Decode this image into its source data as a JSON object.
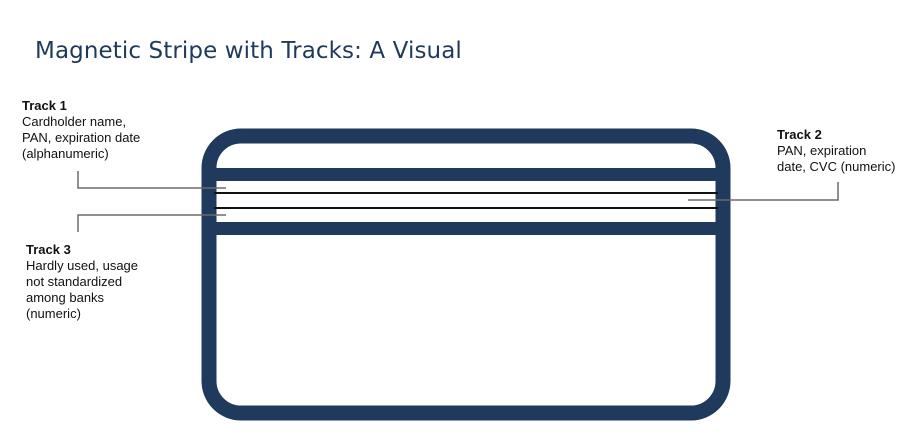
{
  "title": "Magnetic Stripe with Tracks: A Visual",
  "colors": {
    "card_outline": "#1f3a5c",
    "leader_line": "#6b6b6b",
    "track_line": "#111111",
    "title": "#1f3a5c"
  },
  "tracks": [
    {
      "name": "Track 1",
      "description": "Cardholder name,\nPAN, expiration date\n(alphanumeric)"
    },
    {
      "name": "Track 2",
      "description": "PAN, expiration\ndate, CVC (numeric)"
    },
    {
      "name": "Track 3",
      "description": "Hardly used, usage\nnot standardized\namong banks\n(numeric)"
    }
  ]
}
